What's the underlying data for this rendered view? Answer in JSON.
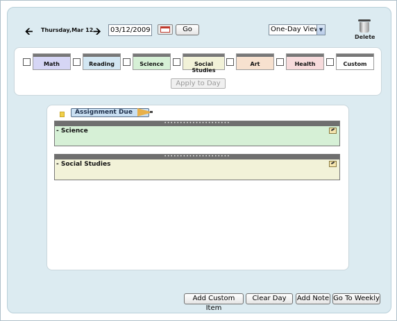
{
  "nav": {
    "date_label": "Thursday,Mar 12",
    "date_value": "03/12/2009",
    "go_label": "Go",
    "view_selected": "One-Day View",
    "delete_label": "Delete"
  },
  "categories": [
    {
      "label": "Math",
      "color": "#d6d6f5"
    },
    {
      "label": "Reading",
      "color": "#d2e6f2"
    },
    {
      "label": "Science",
      "color": "#d6f0d6"
    },
    {
      "label": "Social Studies",
      "color": "#f2f2d8"
    },
    {
      "label": "Art",
      "color": "#f7e1cf"
    },
    {
      "label": "Health",
      "color": "#f7dbdc"
    },
    {
      "label": "Custom",
      "color": "#ffffff"
    }
  ],
  "apply_label": "Apply to Day",
  "assignment_banner": "Assignment Due",
  "sections": [
    {
      "title": "- Science",
      "color": "#d6f0d6"
    },
    {
      "title": "- Social Studies",
      "color": "#f2f2d8"
    }
  ],
  "footer": {
    "add_custom": "Add Custom Item",
    "clear_day": "Clear Day",
    "add_note": "Add Note",
    "go_weekly": "Go To Weekly"
  }
}
